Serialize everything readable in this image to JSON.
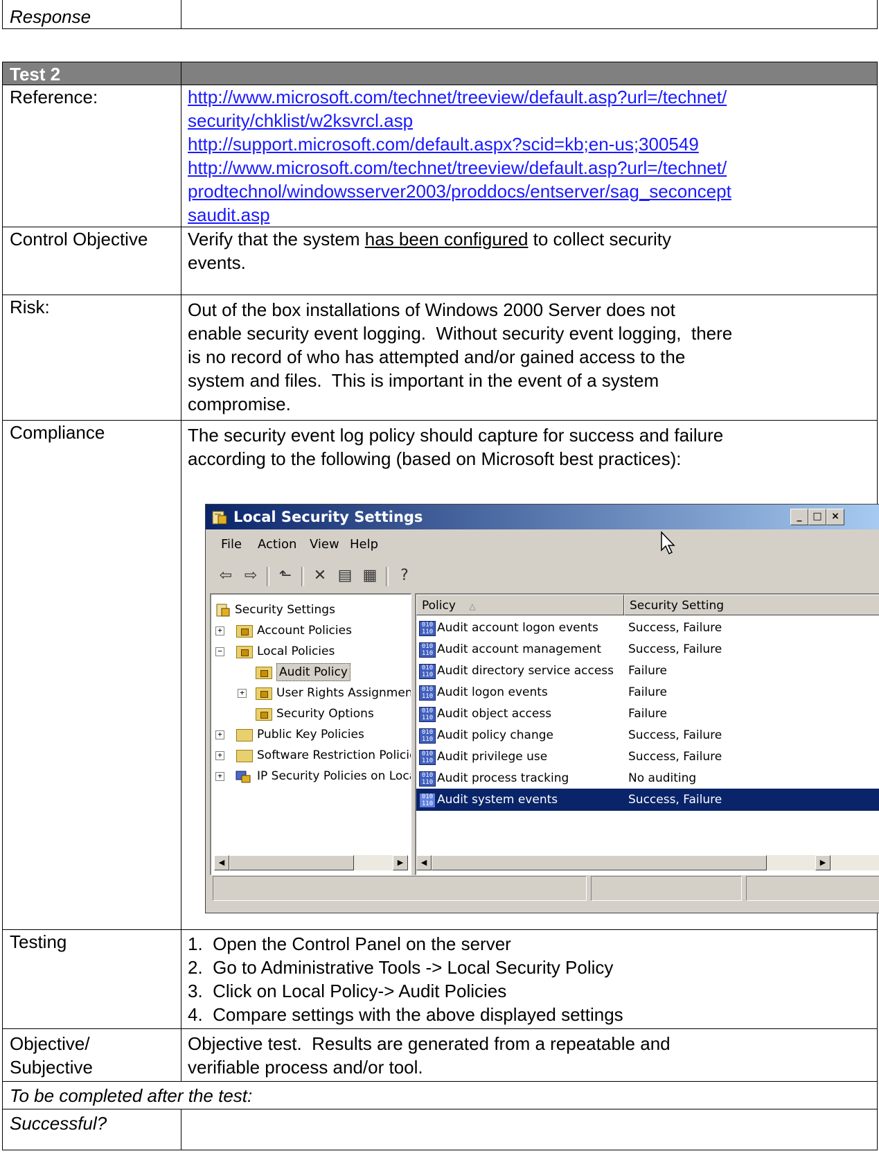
{
  "top_row": {
    "label": "Response",
    "value": ""
  },
  "test": {
    "header": "Test 2",
    "reference_label": "Reference:",
    "reference_links": [
      "http://www.microsoft.com/technet/treeview/default.asp?url=/technet/",
      "security/chklist/w2ksvrcl.asp",
      "http://support.microsoft.com/default.aspx?scid=kb;en-us;300549",
      "http://www.microsoft.com/technet/treeview/default.asp?url=/technet/",
      "prodtechnol/windowsserver2003/proddocs/entserver/sag_seconcept",
      "saudit.asp"
    ],
    "control_objective_label": "Control Objective",
    "control_objective_pre": "Verify that the system ",
    "control_objective_underlined": "has been configured",
    "control_objective_post": " to collect security",
    "control_objective_line2": "events.",
    "risk_label": "Risk:",
    "risk_lines": [
      "Out of the box installations of Windows 2000 Server does not",
      "enable security event logging.  Without security event logging,  there",
      "is no record of who has attempted and/or gained access to the",
      "system and files.  This is important in the event of a system",
      "compromise."
    ],
    "compliance_label": "Compliance",
    "compliance_lines": [
      "The security event log policy should capture for success and failure",
      "according to the following (based on Microsoft best practices):"
    ],
    "testing_label": "Testing",
    "testing_steps": [
      "1.  Open the Control Panel on the server",
      "2.  Go to Administrative Tools -> Local Security Policy",
      "3.  Click on Local Policy-> Audit Policies",
      "4.  Compare settings with the above displayed settings"
    ],
    "objective_label_line1": "Objective/",
    "objective_label_line2": "Subjective",
    "objective_lines": [
      "Objective test.  Results are generated from a repeatable and",
      "verifiable process and/or tool."
    ],
    "completion_note": "To be completed after the test:",
    "successful_label": "Successful?",
    "successful_value": ""
  },
  "window": {
    "title": "Local Security Settings",
    "menu": [
      "File",
      "Action",
      "View",
      "Help"
    ],
    "tree": [
      {
        "label": "Security Settings",
        "icon": "security-settings-icon"
      },
      {
        "label": "Account Policies",
        "icon": "locked-folder-icon"
      },
      {
        "label": "Local Policies",
        "icon": "locked-folder-icon"
      },
      {
        "label": "Audit Policy",
        "icon": "locked-folder-icon"
      },
      {
        "label": "User Rights Assignmen",
        "icon": "locked-folder-icon"
      },
      {
        "label": "Security Options",
        "icon": "locked-folder-icon"
      },
      {
        "label": "Public Key Policies",
        "icon": "folder-icon"
      },
      {
        "label": "Software Restriction Policie",
        "icon": "folder-icon"
      },
      {
        "label": "IP Security Policies on Loca",
        "icon": "ip-security-icon"
      }
    ],
    "columns": {
      "policy": "Policy",
      "setting": "Security Setting"
    },
    "policies": [
      {
        "name": "Audit account logon events",
        "setting": "Success, Failure"
      },
      {
        "name": "Audit account management",
        "setting": "Success, Failure"
      },
      {
        "name": "Audit directory service access",
        "setting": "Failure"
      },
      {
        "name": "Audit logon events",
        "setting": "Failure"
      },
      {
        "name": "Audit object access",
        "setting": "Failure"
      },
      {
        "name": "Audit policy change",
        "setting": "Success, Failure"
      },
      {
        "name": "Audit privilege use",
        "setting": "Success, Failure"
      },
      {
        "name": "Audit process tracking",
        "setting": "No auditing"
      },
      {
        "name": "Audit system events",
        "setting": "Success, Failure",
        "selected": true
      }
    ]
  },
  "colors": {
    "header_bg": "#808080",
    "link": "#1a1aff",
    "selection": "#0a246a",
    "titlebar": "#0a246a"
  }
}
